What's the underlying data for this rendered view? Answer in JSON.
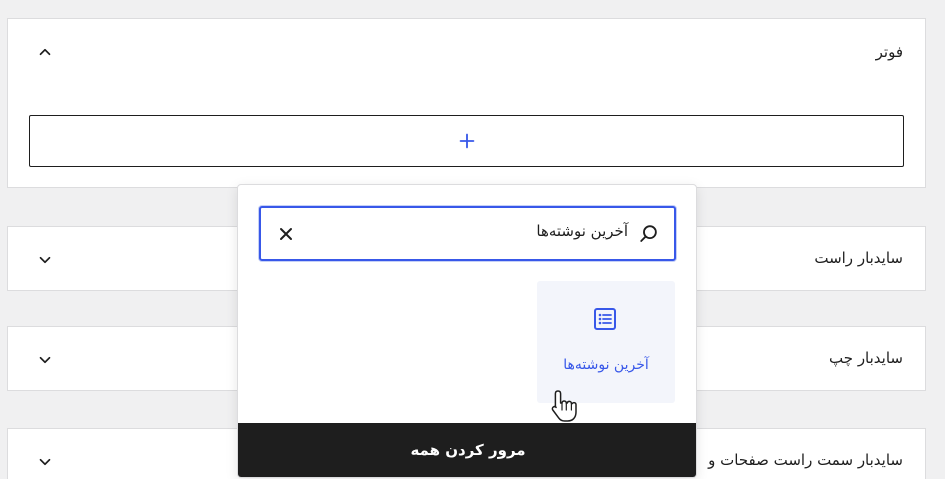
{
  "colors": {
    "accent": "#3858e9",
    "dark": "#1e1e1e",
    "panel_bg": "#ffffff",
    "page_bg": "#f0f0f1",
    "result_bg": "#f3f5fb"
  },
  "panels": {
    "footer": {
      "title": "فوتر",
      "state": "expanded",
      "chevron": "chevron-up-icon",
      "add_icon": "plus-icon"
    },
    "sidebar_right": {
      "title": "سایدبار راست",
      "chevron": "chevron-down-icon"
    },
    "sidebar_left": {
      "title": "سایدبار چپ",
      "chevron": "chevron-down-icon"
    },
    "sidebar_pages": {
      "title": "سایدبار سمت راست صفحات و",
      "chevron": "chevron-down-icon"
    }
  },
  "inserter": {
    "search": {
      "value": "آخرین نوشته‌ها",
      "search_icon": "search-icon",
      "clear_icon": "close-icon"
    },
    "results": [
      {
        "label": "آخرین نوشته‌ها",
        "icon": "post-list-icon"
      }
    ],
    "browse_all_label": "مرور کردن همه"
  }
}
